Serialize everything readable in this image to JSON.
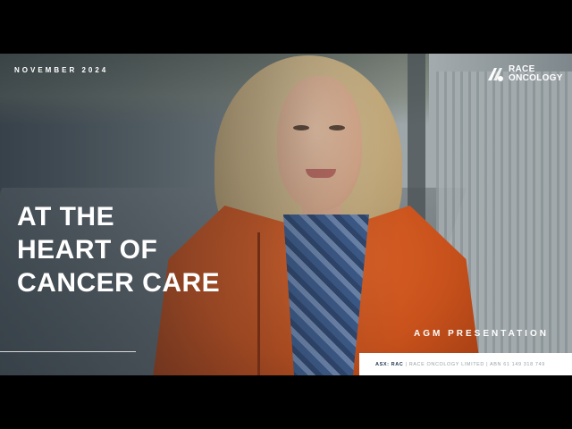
{
  "slide": {
    "date": "NOVEMBER 2024",
    "headline": [
      "AT THE",
      "HEART OF",
      "CANCER CARE"
    ],
    "subtitle": "AGM PRESENTATION",
    "logo": {
      "line1": "RACE",
      "line2": "ONCOLOGY",
      "icon": "race-oncology-logo-icon"
    },
    "footer": {
      "ticker": "ASX: RAC",
      "company": "| RACE ONCOLOGY LIMITED | ABN 61 149 318 749"
    }
  },
  "colors": {
    "accent_orange": "#d95a22",
    "text_white": "#ffffff",
    "footer_navy": "#1f3550"
  }
}
